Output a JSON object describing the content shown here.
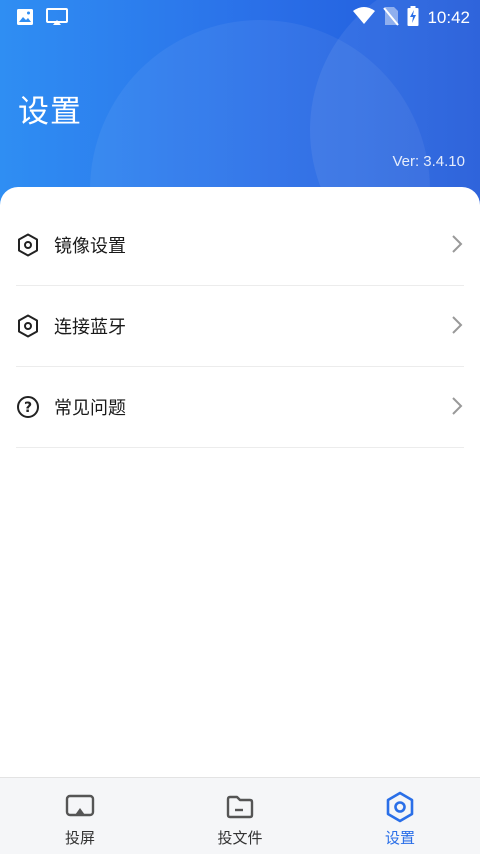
{
  "status_bar": {
    "time": "10:42",
    "left_icons": [
      "image-icon",
      "cast-icon"
    ],
    "right_icons": [
      "wifi-icon",
      "no-sim-icon",
      "battery-charging-icon"
    ]
  },
  "header": {
    "title": "设置",
    "version": "Ver: 3.4.10",
    "gradient_colors": [
      "#2f8ef3",
      "#2059d9"
    ]
  },
  "settings_list": [
    {
      "label": "镜像设置",
      "icon": "hexagon-settings-icon"
    },
    {
      "label": "连接蓝牙",
      "icon": "hexagon-settings-icon"
    },
    {
      "label": "常见问题",
      "icon": "question-circle-icon"
    }
  ],
  "tab_bar": {
    "active": "设置",
    "active_color": "#2a6fe8",
    "tabs": [
      {
        "label": "投屏",
        "icon": "screen-cast-icon"
      },
      {
        "label": "投文件",
        "icon": "folder-icon"
      },
      {
        "label": "设置",
        "icon": "hexagon-settings-icon"
      }
    ]
  }
}
